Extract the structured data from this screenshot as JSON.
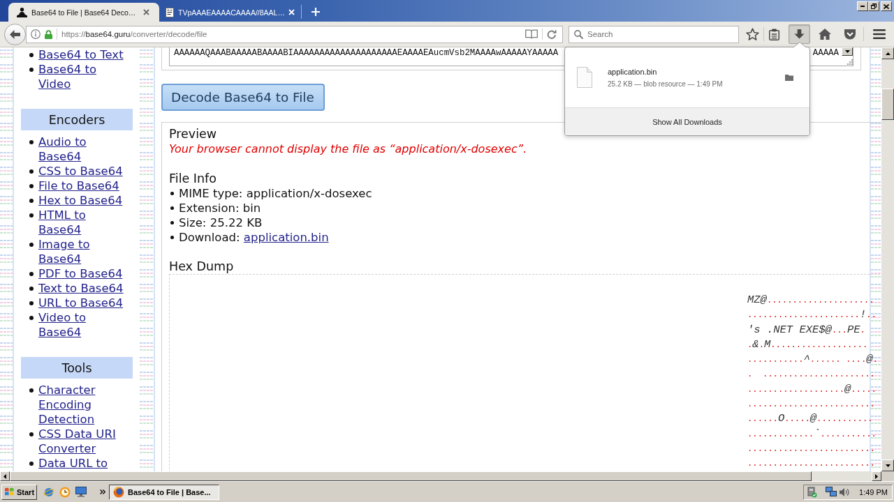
{
  "tabs": [
    {
      "title": "Base64 to File | Base64 Deco…",
      "selected": true
    },
    {
      "title": "TVpAAAEAAAACAAAA//8AAL…",
      "selected": false
    }
  ],
  "address_bar": {
    "scheme": "https://",
    "host": "base64.guru",
    "path": "/converter/decode/file"
  },
  "search": {
    "placeholder": "Search"
  },
  "downloads_button": {
    "pressed": true
  },
  "downloads_panel": {
    "items": [
      {
        "file_name": "application.bin",
        "details": "25.2 KB — blob resource — 1:49 PM"
      }
    ],
    "footer": "Show All Downloads"
  },
  "sidebar": {
    "sections": [
      {
        "links": [
          "Base64 to Text",
          "Base64 to Video"
        ]
      },
      {
        "heading": "Encoders",
        "links": [
          "Audio to Base64",
          "CSS to Base64",
          "File to Base64",
          "Hex to Base64",
          "HTML to Base64",
          "Image to Base64",
          "PDF to Base64",
          "Text to Base64",
          "URL to Base64",
          "Video to Base64"
        ]
      },
      {
        "heading": "Tools",
        "links": [
          "Character Encoding Detection",
          "CSS Data URI Converter",
          "Data URL to"
        ]
      }
    ]
  },
  "input": {
    "text_left": "AAAAAAQAAABAAAAABAAAABIAAAAAAAAAAAAAAAAAAAAEAAAAEAucmVsb2MAAAAwAAAAAYAAAAA",
    "text_right": "AAAAA"
  },
  "decode_button": "Decode Base64 to File",
  "preview": {
    "heading": "Preview",
    "message": "Your browser cannot display the file as “application/x-dosexec”."
  },
  "file_info": {
    "heading": "File Info",
    "items": [
      {
        "kind": "text",
        "text": "MIME type: application/x-dosexec"
      },
      {
        "kind": "text",
        "text": "Extension: bin"
      },
      {
        "kind": "text",
        "text": "Size: 25.22 KB"
      },
      {
        "kind": "link",
        "text": "Download:",
        "link": "application.bin"
      }
    ]
  },
  "hex_dump": {
    "heading": "Hex Dump",
    "ascii_lines": [
      [
        {
          "kind": "glyph",
          "text": "MZ@"
        },
        {
          "kind": "dot",
          "text": "....................."
        }
      ],
      [
        {
          "kind": "dot",
          "text": "......................"
        },
        {
          "kind": "glyph",
          "text": "!"
        },
        {
          "kind": "dot",
          "text": ".."
        }
      ],
      [
        {
          "kind": "glyph",
          "text": "'s .NET EXE$@"
        },
        {
          "kind": "dot",
          "text": "..."
        },
        {
          "kind": "glyph",
          "text": "PE"
        },
        {
          "kind": "dot",
          "text": "."
        }
      ],
      [
        {
          "kind": "dot",
          "text": "."
        },
        {
          "kind": "glyph",
          "text": "&"
        },
        {
          "kind": "dot",
          "text": "."
        },
        {
          "kind": "glyph",
          "text": "M"
        },
        {
          "kind": "dot",
          "text": "..................."
        }
      ],
      [
        {
          "kind": "dot",
          "text": "..........."
        },
        {
          "kind": "glyph",
          "text": "^"
        },
        {
          "kind": "dot",
          "text": "...... ...."
        },
        {
          "kind": "glyph",
          "text": "@"
        },
        {
          "kind": "dot",
          "text": "."
        }
      ],
      [
        {
          "kind": "dot",
          "text": ".  ......................"
        }
      ],
      [
        {
          "kind": "dot",
          "text": "..................."
        },
        {
          "kind": "glyph",
          "text": "@"
        },
        {
          "kind": "dot",
          "text": "....."
        }
      ],
      [
        {
          "kind": "dot",
          "text": "........................."
        }
      ],
      [
        {
          "kind": "dot",
          "text": "......"
        },
        {
          "kind": "glyph",
          "text": "O"
        },
        {
          "kind": "dot",
          "text": "....."
        },
        {
          "kind": "glyph",
          "text": "@"
        },
        {
          "kind": "dot",
          "text": "..........."
        }
      ],
      [
        {
          "kind": "dot",
          "text": "............."
        },
        {
          "kind": "glyph",
          "text": "`"
        },
        {
          "kind": "dot",
          "text": "..........."
        }
      ],
      [
        {
          "kind": "dot",
          "text": "........................."
        }
      ],
      [
        {
          "kind": "dot",
          "text": "........................."
        }
      ]
    ]
  },
  "taskbar": {
    "start": "Start",
    "tasks": [
      {
        "title": "Base64 to File | Base...",
        "selected": true
      }
    ],
    "clock": "1:49 PM"
  }
}
